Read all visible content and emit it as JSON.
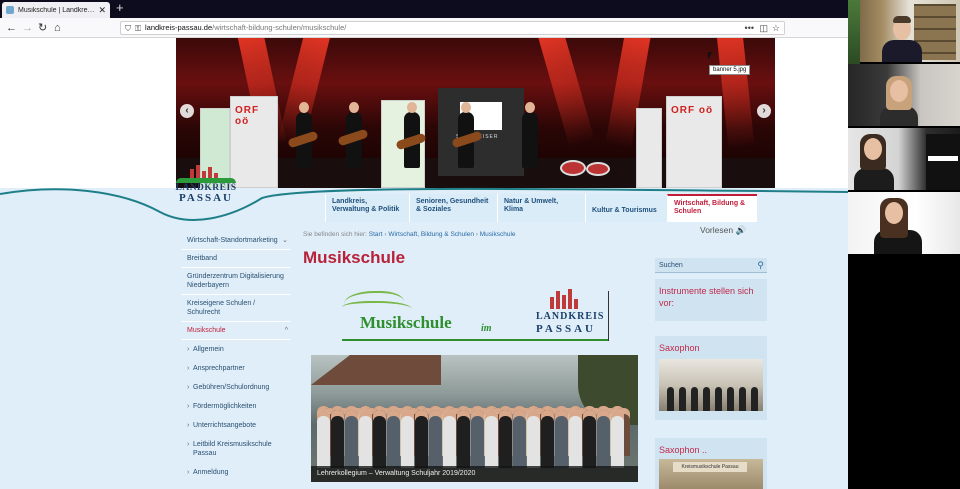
{
  "browser": {
    "tab_title": "Musikschule | Landkreis Passau",
    "tab_close": "✕",
    "new_tab": "+",
    "url_host": "landkreis-passau.de",
    "url_path": "/wirtschaft-bildung-schulen/musikschule/",
    "menu_dots": "•••"
  },
  "banner": {
    "tooltip": "banner 5.jpg",
    "rollup_label": "ORF oö",
    "screen_brand": "SENNHEISER",
    "prev_label": "‹",
    "next_label": "›"
  },
  "logo": {
    "line1": "LANDKREIS",
    "line2": "PASSAU"
  },
  "main_nav": [
    {
      "label": "Landkreis, Verwaltung & Politik"
    },
    {
      "label": "Senioren, Gesundheit & Soziales"
    },
    {
      "label": "Natur & Umwelt, Klima"
    },
    {
      "label": "Kultur & Tourismus"
    },
    {
      "label": "Wirtschaft, Bildung & Schulen"
    }
  ],
  "vorlesen": "Vorlesen 🔊",
  "left_nav": [
    {
      "label": "Wirtschaft-Standortmarketing",
      "chev": "⌄"
    },
    {
      "label": "Breitband"
    },
    {
      "label": "Gründerzentrum Digitalisierung Niederbayern"
    },
    {
      "label": "Kreiseigene Schulen / Schulrecht"
    },
    {
      "label": "Musikschule",
      "chev": "^"
    }
  ],
  "left_sub": [
    "Allgemein",
    "Ansprechpartner",
    "Gebühren/Schulordnung",
    "Fördermöglichkeiten",
    "Unterrichtsangebote",
    "Leitbild Kreismusikschule Passau",
    "Anmeldung"
  ],
  "breadcrumb": {
    "prefix": "Sie befinden sich hier:",
    "items": [
      "Start",
      "Wirtschaft, Bildung & Schulen",
      "Musikschule"
    ],
    "sep": "›"
  },
  "page_title": "Musikschule",
  "music_logo": {
    "word": "Musikschule",
    "im": "im",
    "lk1": "LANDKREIS",
    "lk2": "PASSAU"
  },
  "photo_caption": "Lehrerkollegium – Verwaltung Schuljahr 2019/2020",
  "search": {
    "placeholder": "Suchen",
    "icon": "search-icon"
  },
  "right_boxes": {
    "instruments_title": "Instrumente stellen sich vor:",
    "sax1_title": "Saxophon",
    "sax2_title": "Saxophon ..",
    "sax2_plate": "Kreismusikschule Passau"
  },
  "colors": {
    "accent_red": "#b8213a",
    "nav_blue": "#1f4f7c",
    "page_bg": "#dfeef8",
    "tab_bar": "#0c0c1e"
  }
}
